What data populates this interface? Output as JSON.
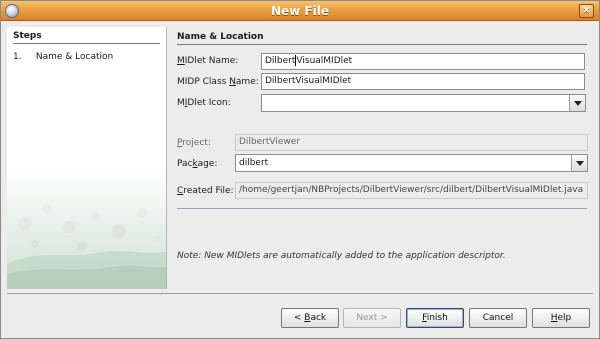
{
  "window": {
    "title": "New File",
    "close_glyph": "×"
  },
  "steps": {
    "title": "Steps",
    "items": [
      {
        "number": "1.",
        "label": "Name & Location"
      }
    ]
  },
  "section": {
    "title": "Name & Location"
  },
  "form": {
    "midlet_name": {
      "label_mnemonic": "M",
      "label_rest": "IDlet Name:",
      "value_before_caret": "Dilbert",
      "value_after_caret": "VisualMIDlet"
    },
    "midp_class_name": {
      "label_pre": "MIDP Class ",
      "label_mnemonic": "N",
      "label_rest": "ame:",
      "value": "DilbertVisualMIDlet"
    },
    "midlet_icon": {
      "label_pre": "M",
      "label_mnemonic": "I",
      "label_rest": "Dlet Icon:",
      "value": ""
    },
    "project": {
      "label_mnemonic": "P",
      "label_rest": "roject:",
      "value": "DilbertViewer"
    },
    "package": {
      "label_pre": "Pac",
      "label_mnemonic": "k",
      "label_rest": "age:",
      "value": "dilbert"
    },
    "created_file": {
      "label_mnemonic": "C",
      "label_rest": "reated File:",
      "value": "/home/geertjan/NBProjects/DilbertViewer/src/dilbert/DilbertVisualMIDlet.java"
    }
  },
  "note": "Note: New MIDlets are automatically added to the application descriptor.",
  "buttons": {
    "back": {
      "pre": "< ",
      "mnemonic": "B",
      "rest": "ack"
    },
    "next": {
      "label": "Next >"
    },
    "finish": {
      "mnemonic": "F",
      "rest": "inish"
    },
    "cancel": {
      "label": "Cancel"
    },
    "help": {
      "mnemonic": "H",
      "rest": "elp"
    }
  },
  "colors": {
    "titlebar": "#e9a03e",
    "accent_border": "#334a75",
    "steps_art": "#cfe0d3"
  },
  "icons": [
    "window-app-icon",
    "close-icon",
    "chevron-down-icon"
  ]
}
